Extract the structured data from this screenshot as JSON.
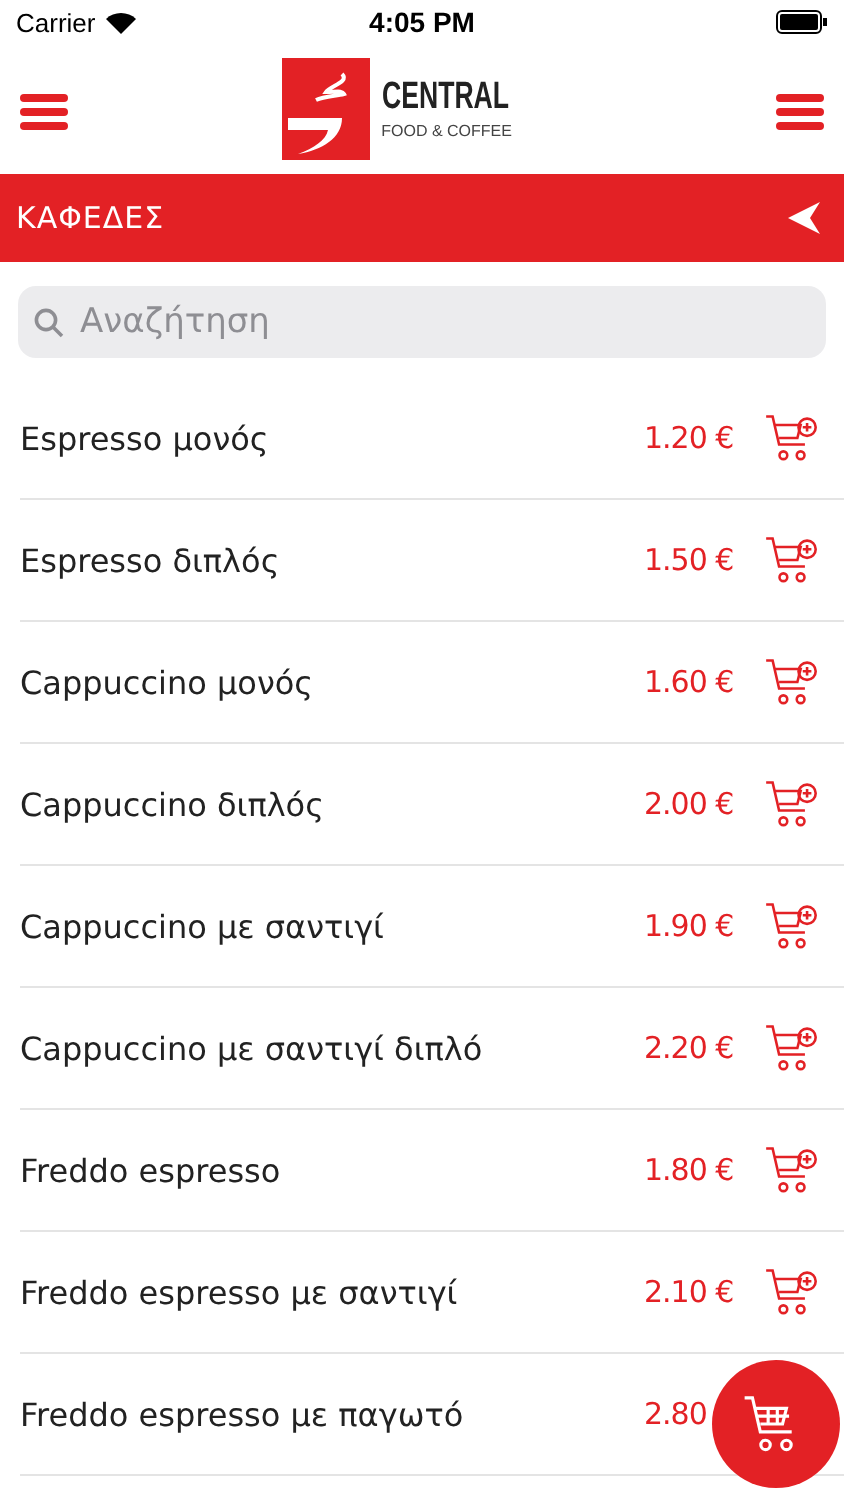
{
  "status_bar": {
    "carrier": "Carrier",
    "time": "4:05 PM"
  },
  "header": {
    "brand": "CENTRAL",
    "tagline": "FOOD & COFFEE"
  },
  "category": {
    "title": "ΚΑΦΕΔΕΣ"
  },
  "search": {
    "placeholder": "Αναζήτηση"
  },
  "items": [
    {
      "name": "Espresso μονός",
      "price": "1.20 €"
    },
    {
      "name": "Espresso διπλός",
      "price": "1.50 €"
    },
    {
      "name": "Cappuccino μονός",
      "price": "1.60 €"
    },
    {
      "name": "Cappuccino διπλός",
      "price": "2.00 €"
    },
    {
      "name": "Cappuccino με σαντιγί",
      "price": "1.90 €"
    },
    {
      "name": "Cappuccino με σαντιγί διπλό",
      "price": "2.20 €"
    },
    {
      "name": "Freddo espresso",
      "price": "1.80 €"
    },
    {
      "name": "Freddo espresso με σαντιγί",
      "price": "2.10 €"
    },
    {
      "name": "Freddo espresso με παγωτό",
      "price": "2.80"
    }
  ]
}
